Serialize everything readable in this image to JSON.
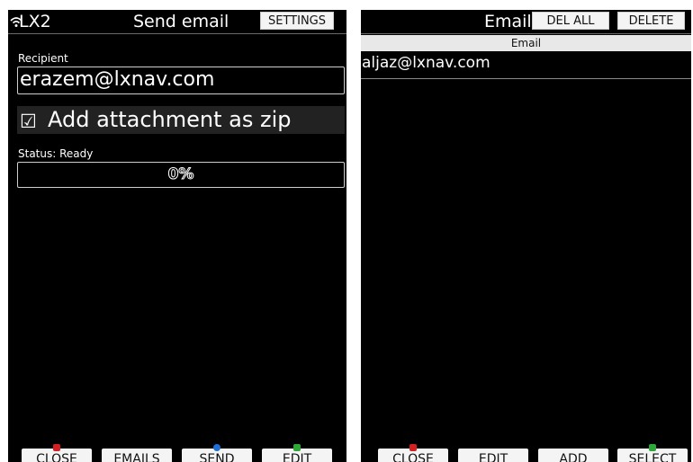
{
  "left": {
    "app": "LX2",
    "title": "Send email",
    "settings_label": "SETTINGS",
    "recipient_label": "Recipient",
    "recipient_value": "erazem@lxnav.com",
    "attachment_checked": true,
    "attachment_label": "Add attachment as zip",
    "status_label": "Status: Ready",
    "progress_text": "0%",
    "progress_percent": 0,
    "buttons": [
      "CLOSE",
      "EMAILS",
      "SEND",
      "EDIT"
    ]
  },
  "right": {
    "title": "Email A",
    "del_all_label": "DEL ALL",
    "delete_label": "DELETE",
    "column_header": "Email",
    "rows": [
      "aljaz@lxnav.com"
    ],
    "buttons": [
      "CLOSE",
      "EDIT",
      "ADD",
      "SELECT"
    ]
  },
  "colors": {
    "background": "#000000",
    "button": "#f4f4f4",
    "close_icon": "#d42020",
    "send_icon": "#1f6fd6",
    "ok_icon": "#2fa83a"
  },
  "icons": [
    "wifi-icon",
    "checkbox-icon",
    "close-icon",
    "send-icon",
    "check-icon"
  ]
}
